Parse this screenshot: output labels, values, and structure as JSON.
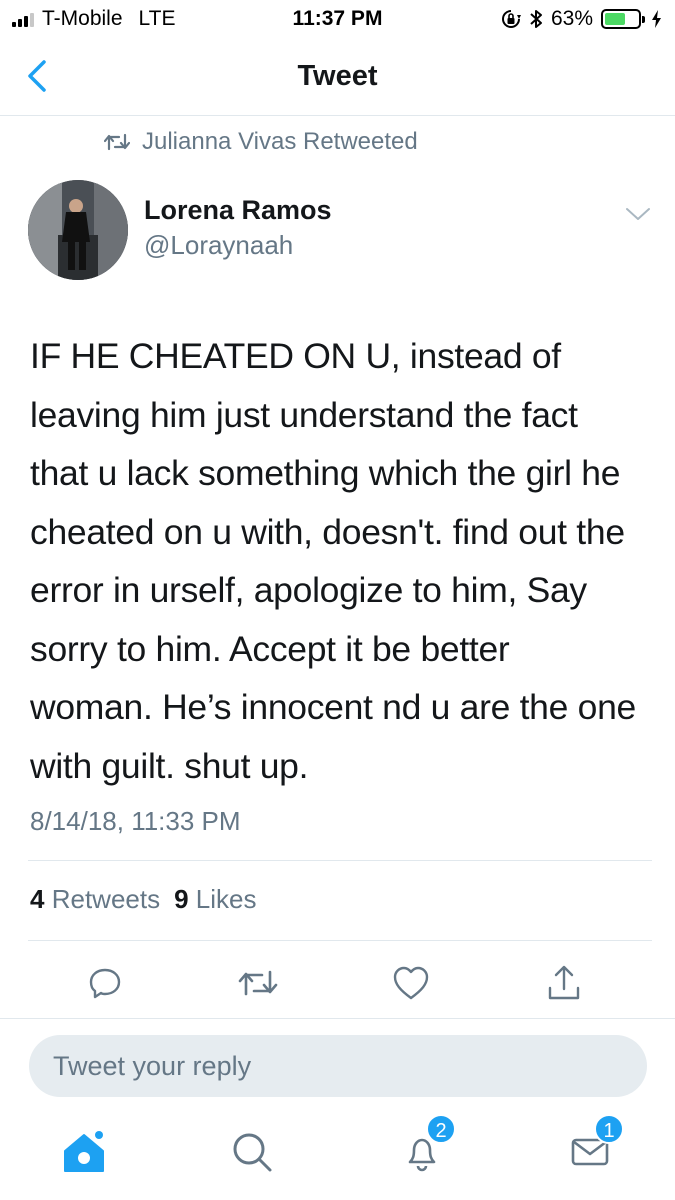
{
  "status_bar": {
    "carrier": "T-Mobile",
    "network": "LTE",
    "time": "11:37 PM",
    "battery_percent": "63%",
    "battery_level": 0.63,
    "battery_color": "#4cd964",
    "icons": [
      "signal-icon",
      "orientation-lock-icon",
      "bluetooth-icon",
      "battery-icon",
      "charging-bolt-icon"
    ]
  },
  "nav": {
    "back_icon": "chevron-left-icon",
    "title": "Tweet"
  },
  "retweet": {
    "icon": "retweet-icon",
    "label": "Julianna Vivas Retweeted"
  },
  "author": {
    "name": "Lorena Ramos",
    "handle": "@Loraynaah"
  },
  "tweet": {
    "text": "IF HE CHEATED ON U, instead of leaving him just understand the fact that u lack something which the girl he cheated on u with, doesn't. find out the error in urself, apologize to him, Say sorry to him. Accept it be better woman. He’s innocent nd u are the one with guilt. shut up.",
    "timestamp": "8/14/18, 11:33 PM"
  },
  "stats": {
    "retweets_count": "4",
    "retweets_label": "Retweets",
    "likes_count": "9",
    "likes_label": "Likes"
  },
  "actions": [
    "reply-icon",
    "retweet-icon",
    "like-icon",
    "share-icon"
  ],
  "reply": {
    "placeholder": "Tweet your reply"
  },
  "tabbar": {
    "notifications_badge": "2",
    "messages_badge": "1",
    "accent_color": "#1da1f2"
  }
}
